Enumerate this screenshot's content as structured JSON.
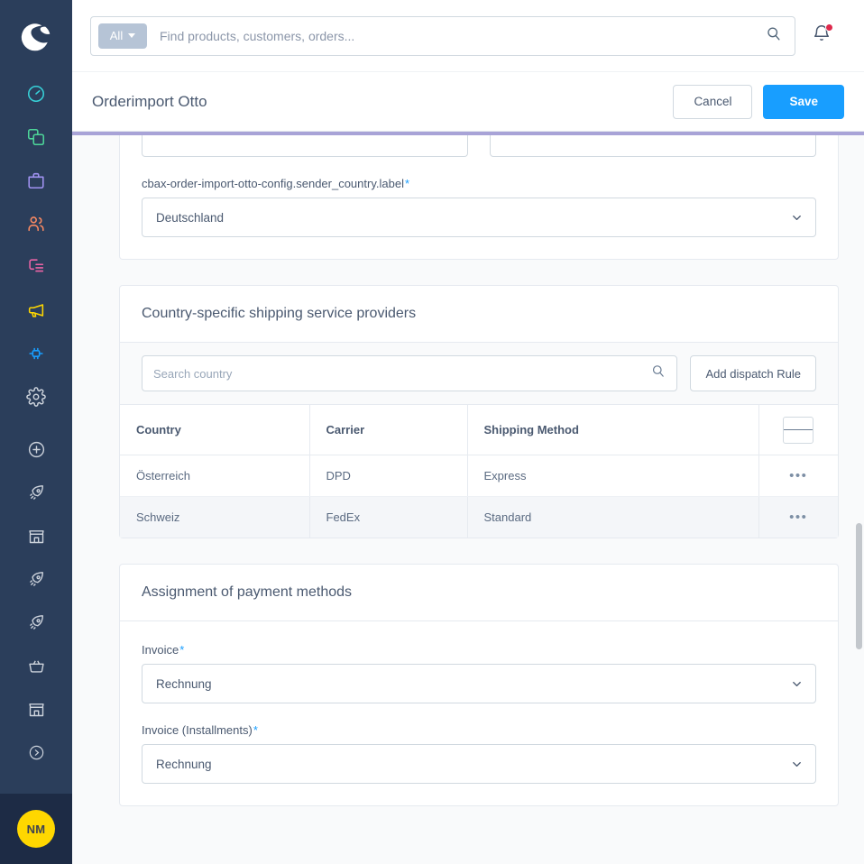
{
  "brand": {
    "logo": "shopware-logo",
    "accent": "#189eff",
    "sidebar_bg": "#2b3e5b"
  },
  "sidebar": {
    "items": [
      {
        "name": "dashboard",
        "icon": "dashboard-gauge-icon",
        "color": "#37d1d8"
      },
      {
        "name": "catalogues",
        "icon": "catalogue-layers-icon",
        "color": "#4dd599"
      },
      {
        "name": "orders",
        "icon": "orders-bag-icon",
        "color": "#a092f1"
      },
      {
        "name": "customers",
        "icon": "customers-people-icon",
        "color": "#f88962"
      },
      {
        "name": "content",
        "icon": "content-document-icon",
        "color": "#ed64a6"
      },
      {
        "name": "marketing",
        "icon": "marketing-megaphone-icon",
        "color": "#ffd700"
      },
      {
        "name": "extensions",
        "icon": "extensions-plug-icon",
        "color": "#189eff"
      },
      {
        "name": "settings",
        "icon": "settings-gear-icon",
        "color": "#cdd3dc"
      },
      {
        "name": "add-plugin",
        "icon": "plus-circle-icon",
        "color": "#cdd3dc"
      },
      {
        "name": "rocket-app-1",
        "icon": "rocket-icon",
        "color": "#cdd3dc"
      },
      {
        "name": "store-1",
        "icon": "storefront-icon",
        "color": "#cdd3dc"
      },
      {
        "name": "rocket-app-2",
        "icon": "rocket-icon",
        "color": "#cdd3dc"
      },
      {
        "name": "rocket-app-3",
        "icon": "rocket-icon",
        "color": "#cdd3dc"
      },
      {
        "name": "basket-app",
        "icon": "basket-icon",
        "color": "#cdd3dc"
      },
      {
        "name": "store-2",
        "icon": "storefront-icon",
        "color": "#cdd3dc"
      },
      {
        "name": "expand-menu",
        "icon": "chevron-right-circle-icon",
        "color": "#cdd3dc"
      }
    ],
    "avatar_initials": "NM"
  },
  "topbar": {
    "scope_label": "All",
    "search_placeholder": "Find products, customers, orders...",
    "search_value": "",
    "search_icon": "search-icon",
    "notification_icon": "bell-icon",
    "has_notification": true
  },
  "page_header": {
    "title": "Orderimport Otto",
    "cancel_label": "Cancel",
    "save_label": "Save",
    "loading_bar_color": "#a8a3d7"
  },
  "sender_card": {
    "country_label": "cbax-order-import-otto-config.sender_country.label",
    "country_required": "*",
    "country_value": "Deutschland"
  },
  "shipping_card": {
    "title": "Country-specific shipping service providers",
    "search_placeholder": "Search country",
    "search_value": "",
    "add_rule_label": "Add dispatch Rule",
    "columns": [
      "Country",
      "Carrier",
      "Shipping Method"
    ],
    "rows": [
      {
        "country": "Österreich",
        "carrier": "DPD",
        "method": "Express",
        "actions": "•••"
      },
      {
        "country": "Schweiz",
        "carrier": "FedEx",
        "method": "Standard",
        "actions": "•••"
      }
    ]
  },
  "payment_card": {
    "title": "Assignment of payment methods",
    "fields": [
      {
        "label": "Invoice",
        "required": "*",
        "value": "Rechnung"
      },
      {
        "label": "Invoice (Installments)",
        "required": "*",
        "value": "Rechnung"
      }
    ]
  }
}
